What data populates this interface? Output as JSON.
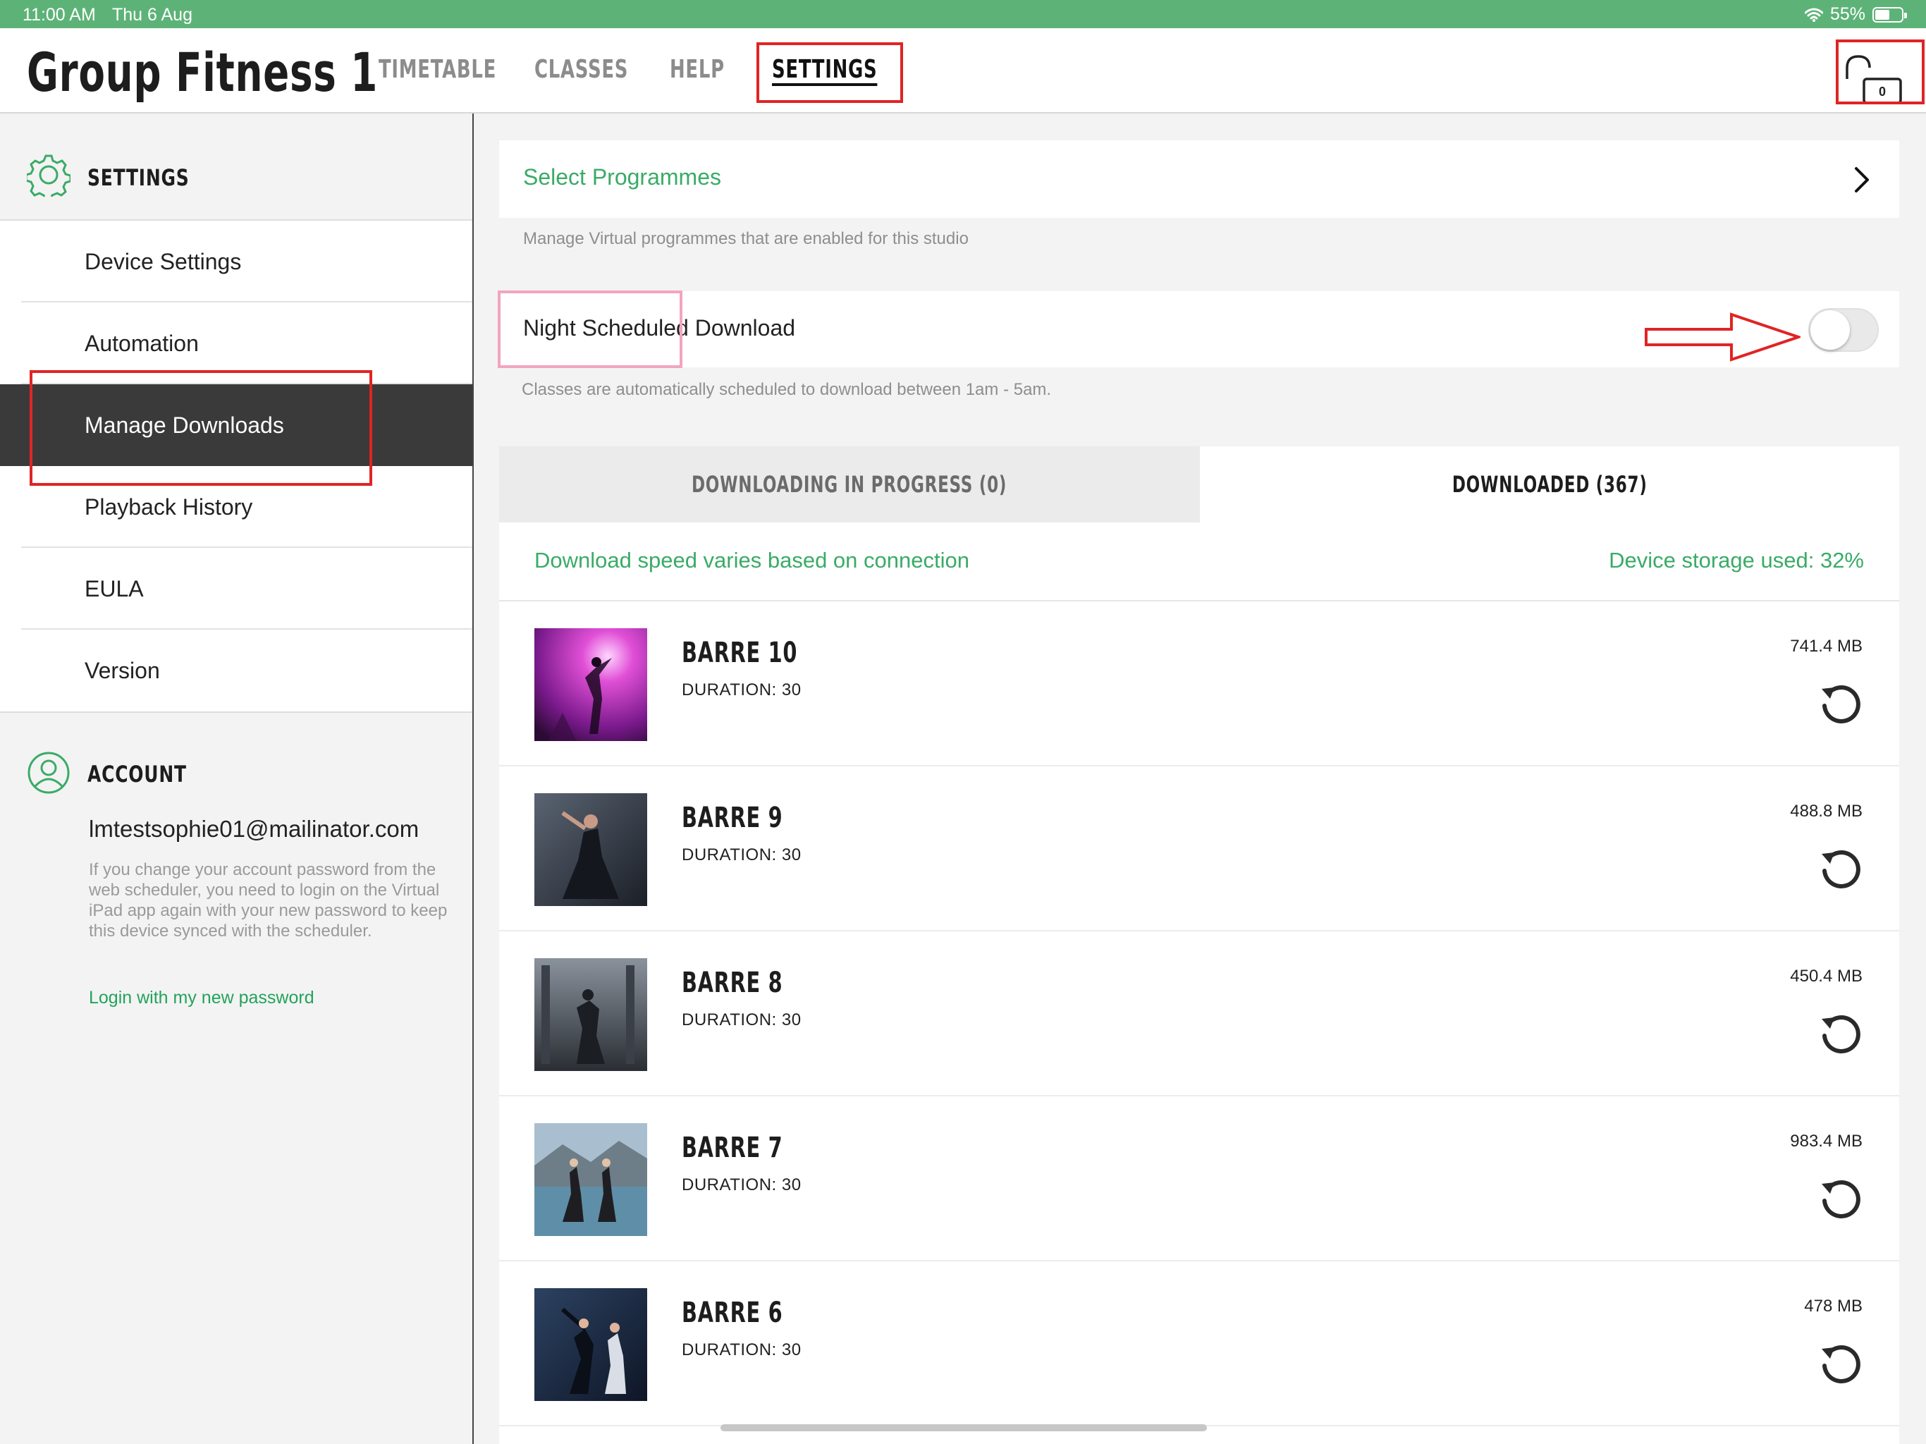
{
  "status_bar": {
    "time": "11:00 AM",
    "date": "Thu 6 Aug",
    "battery": "55%",
    "battery_level": 0.55,
    "wifi_icon": "wifi-icon"
  },
  "header": {
    "title": "Group Fitness 1",
    "tabs": [
      {
        "label": "TIMETABLE"
      },
      {
        "label": "CLASSES"
      },
      {
        "label": "HELP"
      },
      {
        "label": "SETTINGS"
      }
    ],
    "active_tab": "SETTINGS",
    "lock_badge": "0"
  },
  "sidebar": {
    "settings_heading": "SETTINGS",
    "items": [
      {
        "label": "Device Settings"
      },
      {
        "label": "Automation"
      },
      {
        "label": "Manage Downloads"
      },
      {
        "label": "Playback History"
      },
      {
        "label": "EULA"
      },
      {
        "label": "Version"
      }
    ],
    "active_item": "Manage Downloads",
    "account": {
      "heading": "ACCOUNT",
      "email": "lmtestsophie01@mailinator.com",
      "note": "If you change your account password from the web scheduler, you need to login on the Virtual iPad app again with your new password to keep this device synced with the scheduler.",
      "link": "Login with my new password"
    }
  },
  "main": {
    "select_programmes": {
      "label": "Select Programmes",
      "caption": "Manage Virtual programmes that are enabled for this studio"
    },
    "night_download": {
      "label": "Night Scheduled Download",
      "enabled": false,
      "caption": "Classes are automatically scheduled to download between 1am - 5am."
    },
    "tabs": {
      "in_progress": "DOWNLOADING IN PROGRESS (0)",
      "downloaded": "DOWNLOADED (367)"
    },
    "info": {
      "speed": "Download speed varies based on connection",
      "storage": "Device storage used: 32%"
    },
    "downloads": [
      {
        "name": "BARRE 10",
        "duration": "DURATION: 30",
        "size": "741.4 MB"
      },
      {
        "name": "BARRE 9",
        "duration": "DURATION: 30",
        "size": "488.8 MB"
      },
      {
        "name": "BARRE 8",
        "duration": "DURATION: 30",
        "size": "450.4 MB"
      },
      {
        "name": "BARRE 7",
        "duration": "DURATION: 30",
        "size": "983.4 MB"
      },
      {
        "name": "BARRE 6",
        "duration": "DURATION: 30",
        "size": "478 MB"
      }
    ]
  },
  "colors": {
    "accent_green": "#3aab66",
    "status_green": "#5db377",
    "annotation_red": "#e02424",
    "annotation_pink": "#f2a4c0"
  }
}
